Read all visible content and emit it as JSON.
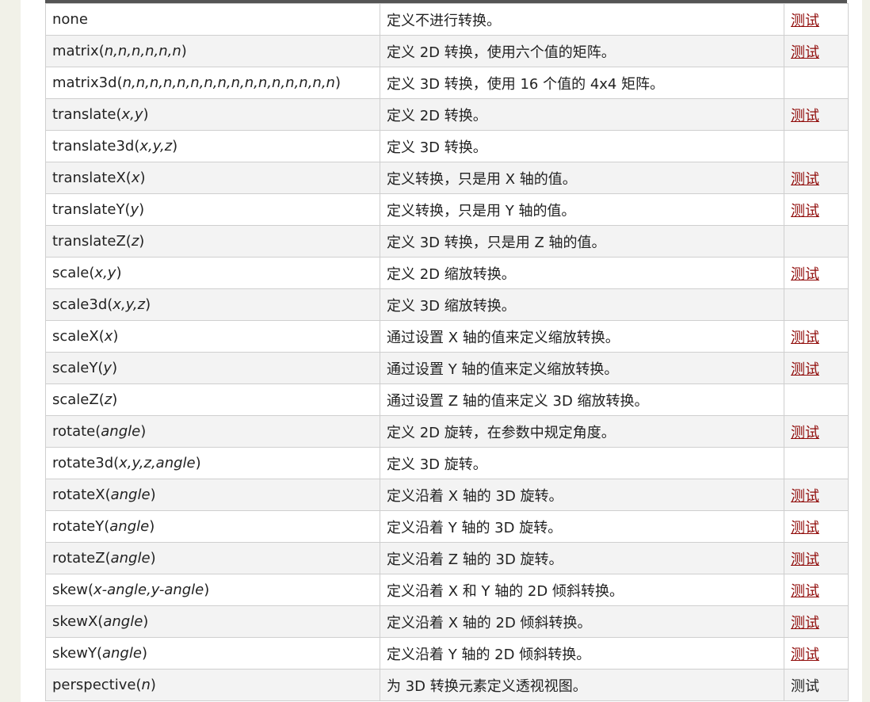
{
  "rows": [
    {
      "name": "none",
      "args": "",
      "desc": "定义不进行转换。",
      "test": "测试",
      "test_link": true
    },
    {
      "name": "matrix",
      "args": "n,n,n,n,n,n",
      "desc": "定义 2D 转换，使用六个值的矩阵。",
      "test": "测试",
      "test_link": true
    },
    {
      "name": "matrix3d",
      "args": "n,n,n,n,n,n,n,n,n,n,n,n,n,n,n,n",
      "desc": "定义 3D 转换，使用 16 个值的 4x4 矩阵。",
      "test": "",
      "test_link": false
    },
    {
      "name": "translate",
      "args": "x,y",
      "desc": "定义 2D 转换。",
      "test": "测试",
      "test_link": true
    },
    {
      "name": "translate3d",
      "args": "x,y,z",
      "desc": "定义 3D 转换。",
      "test": "",
      "test_link": false
    },
    {
      "name": "translateX",
      "args": "x",
      "desc": "定义转换，只是用 X 轴的值。",
      "test": "测试",
      "test_link": true
    },
    {
      "name": "translateY",
      "args": "y",
      "desc": "定义转换，只是用 Y 轴的值。",
      "test": "测试",
      "test_link": true
    },
    {
      "name": "translateZ",
      "args": "z",
      "desc": "定义 3D 转换，只是用 Z 轴的值。",
      "test": "",
      "test_link": false
    },
    {
      "name": "scale",
      "args": "x,y",
      "desc": "定义 2D 缩放转换。",
      "test": "测试",
      "test_link": true
    },
    {
      "name": "scale3d",
      "args": "x,y,z",
      "desc": "定义 3D 缩放转换。",
      "test": "",
      "test_link": false
    },
    {
      "name": "scaleX",
      "args": "x",
      "desc": "通过设置 X 轴的值来定义缩放转换。",
      "test": "测试",
      "test_link": true
    },
    {
      "name": "scaleY",
      "args": "y",
      "desc": "通过设置 Y 轴的值来定义缩放转换。",
      "test": "测试",
      "test_link": true
    },
    {
      "name": "scaleZ",
      "args": "z",
      "desc": "通过设置 Z 轴的值来定义 3D 缩放转换。",
      "test": "",
      "test_link": false
    },
    {
      "name": "rotate",
      "args": "angle",
      "desc": "定义 2D 旋转，在参数中规定角度。",
      "test": "测试",
      "test_link": true
    },
    {
      "name": "rotate3d",
      "args": "x,y,z,angle",
      "desc": "定义 3D 旋转。",
      "test": "",
      "test_link": false
    },
    {
      "name": "rotateX",
      "args": "angle",
      "desc": "定义沿着 X 轴的 3D 旋转。",
      "test": "测试",
      "test_link": true
    },
    {
      "name": "rotateY",
      "args": "angle",
      "desc": "定义沿着 Y 轴的 3D 旋转。",
      "test": "测试",
      "test_link": true
    },
    {
      "name": "rotateZ",
      "args": "angle",
      "desc": "定义沿着 Z 轴的 3D 旋转。",
      "test": "测试",
      "test_link": true
    },
    {
      "name": "skew",
      "args": "x-angle,y-angle",
      "desc": "定义沿着 X 和 Y 轴的 2D 倾斜转换。",
      "test": "测试",
      "test_link": true
    },
    {
      "name": "skewX",
      "args": "angle",
      "desc": "定义沿着 X 轴的 2D 倾斜转换。",
      "test": "测试",
      "test_link": true
    },
    {
      "name": "skewY",
      "args": "angle",
      "desc": "定义沿着 Y 轴的 2D 倾斜转换。",
      "test": "测试",
      "test_link": true
    },
    {
      "name": "perspective",
      "args": "n",
      "desc": "为 3D 转换元素定义透视视图。",
      "test": "测试",
      "test_link": false
    }
  ],
  "colors": {
    "link": "#900b09",
    "text": "#222222",
    "row_alt": "#f3f3f3",
    "border": "#cfcfcf",
    "header_bar": "#555555"
  }
}
